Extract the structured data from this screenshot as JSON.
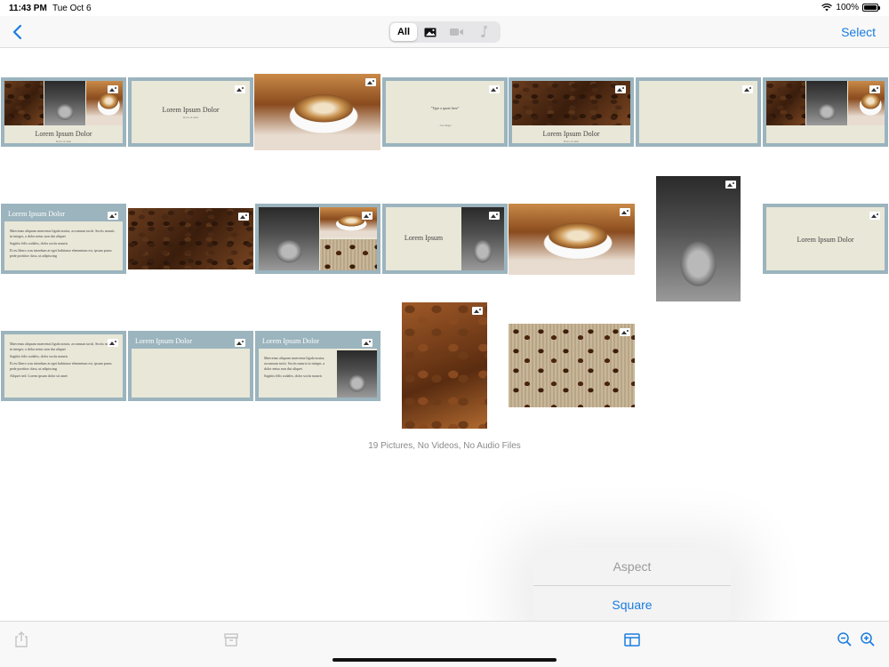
{
  "status_bar": {
    "time": "11:43 PM",
    "date": "Tue Oct 6",
    "battery": "100%"
  },
  "nav": {
    "segments": [
      {
        "label": "All",
        "icon": "all",
        "active": true
      },
      {
        "label": "",
        "icon": "photo-icon",
        "active": false
      },
      {
        "label": "",
        "icon": "video-icon",
        "active": false
      },
      {
        "label": "",
        "icon": "music-note-icon",
        "active": false
      }
    ],
    "select_label": "Select"
  },
  "slides": {
    "lorem_ipsum_dolor": "Lorem Ipsum Dolor",
    "lorem_ipsum": "Lorem Ipsum",
    "quote_text": "\"Type a quote here\"",
    "quote_author": "- Jon Singer",
    "subtitle": "Dolor sit amet",
    "bullets": [
      "Maecenas aliquam maecenas ligula nostra, accumsan taciti. Sociis mauris in integer, a dolor netus non dui aliquet",
      "Sagittis felis sodales, dolor sociis mauris",
      "Et eu libero cras interdum at eget habitasse elementum est, ipsum purus pede porttitor class, ut adipiscing",
      "Aliquet sed. Lorem ipsum dolor sit amet"
    ]
  },
  "count_label": "19 Pictures, No Videos, No Audio Files",
  "popover": {
    "items": [
      {
        "label": "Aspect",
        "enabled": false
      },
      {
        "label": "Square",
        "enabled": true
      }
    ]
  },
  "colors": {
    "accent": "#1a7ce0",
    "slide_frame": "#9bb4be",
    "slide_bg": "#e9e7d8"
  }
}
